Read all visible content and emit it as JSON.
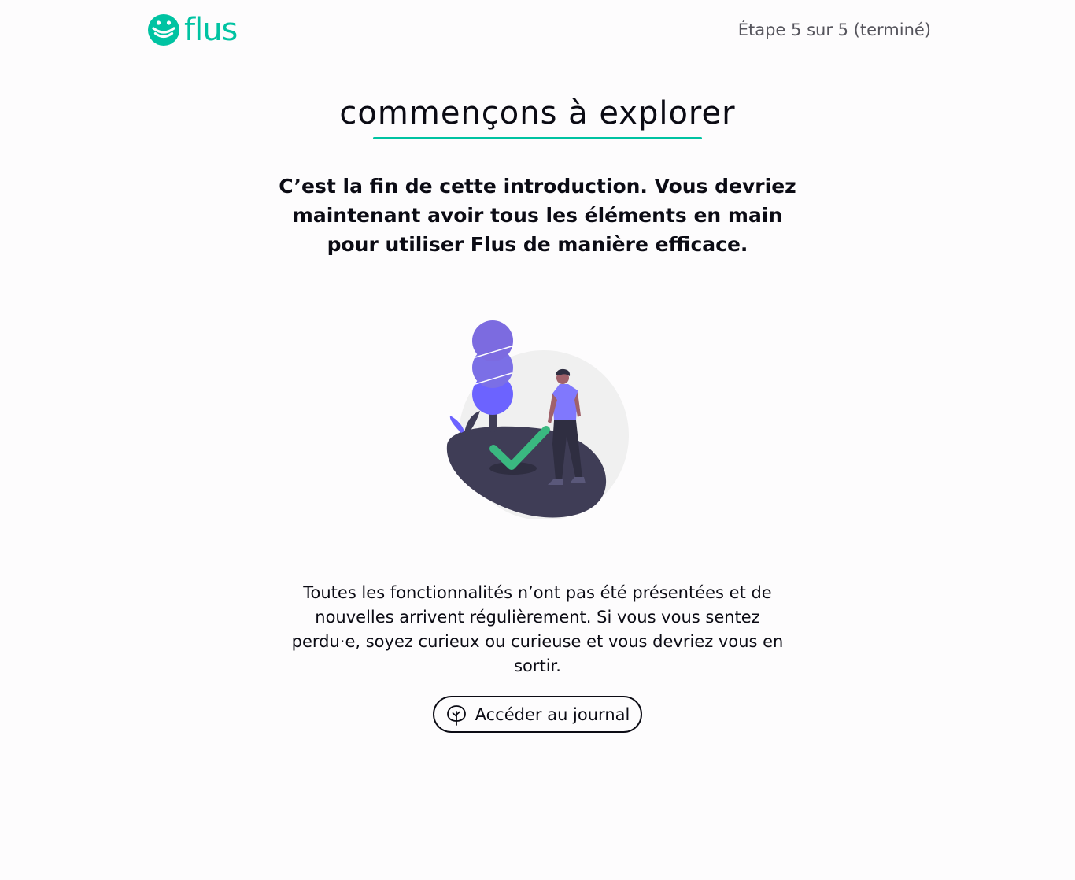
{
  "header": {
    "logo_text": "flus",
    "step_indicator": "Étape 5 sur 5 (terminé)"
  },
  "main": {
    "title": "commençons à explorer",
    "lead": "C’est la fin de cette introduction. Vous devriez maintenant avoir tous les éléments en main pour utiliser Flus de manière efficace.",
    "body": "Toutes les fonctionnalités n’ont pas été présentées et de nouvelles arrivent régulièrement. Si vous vous sentez perdu·e, soyez curieux ou curieuse et vous devriez vous en sortir.",
    "journal_button_label": "Accéder au journal",
    "journal_button_icon": "tree-icon"
  },
  "colors": {
    "brand": "#00c3a2",
    "text": "#0b0b14",
    "muted_text": "#55545c",
    "background": "#fdfcfd",
    "tree": "#6c63ff",
    "ground": "#3f3d56",
    "check": "#3ab880"
  }
}
